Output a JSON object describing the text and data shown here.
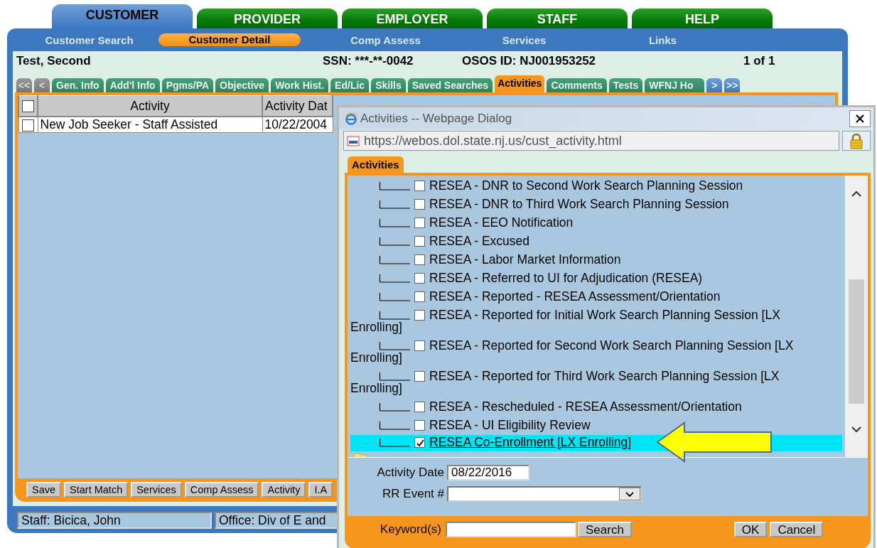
{
  "main_tabs": [
    {
      "label": "CUSTOMER",
      "selected": true
    },
    {
      "label": "PROVIDER",
      "selected": false
    },
    {
      "label": "EMPLOYER",
      "selected": false
    },
    {
      "label": "STAFF",
      "selected": false
    },
    {
      "label": "HELP",
      "selected": false
    }
  ],
  "sub_nav": [
    {
      "label": "Customer Search",
      "selected": false
    },
    {
      "label": "Customer Detail",
      "selected": true
    },
    {
      "label": "Comp Assess",
      "selected": false
    },
    {
      "label": "Services",
      "selected": false
    },
    {
      "label": "Links",
      "selected": false
    }
  ],
  "customer": {
    "name": "Test, Second",
    "ssn": "SSN: ***-**-0042",
    "osos_id": "OSOS ID: NJ001953252",
    "record_count": "1 of 1"
  },
  "detail_tabs": [
    {
      "label": "<<",
      "kind": "nav",
      "disabled": true,
      "selected": false
    },
    {
      "label": "<",
      "kind": "nav",
      "disabled": true,
      "selected": false
    },
    {
      "label": "Gen. Info",
      "kind": "tab",
      "selected": false
    },
    {
      "label": "Add'l Info",
      "kind": "tab",
      "selected": false
    },
    {
      "label": "Pgms/PA",
      "kind": "tab",
      "selected": false
    },
    {
      "label": "Objective",
      "kind": "tab",
      "selected": false
    },
    {
      "label": "Work Hist.",
      "kind": "tab",
      "selected": false
    },
    {
      "label": "Ed/Lic",
      "kind": "tab",
      "selected": false
    },
    {
      "label": "Skills",
      "kind": "tab",
      "selected": false
    },
    {
      "label": "Saved Searches",
      "kind": "tab",
      "selected": false
    },
    {
      "label": "Activities",
      "kind": "tab",
      "selected": true
    },
    {
      "label": "Comments",
      "kind": "tab",
      "selected": false
    },
    {
      "label": "Tests",
      "kind": "tab",
      "selected": false
    },
    {
      "label": "WFNJ Ho",
      "kind": "tab",
      "selected": false
    },
    {
      "label": ">",
      "kind": "nav",
      "disabled": false,
      "selected": false
    },
    {
      "label": ">>",
      "kind": "nav",
      "disabled": false,
      "selected": false
    }
  ],
  "table": {
    "select_all_checked": false,
    "columns": [
      "Activity",
      "Activity Dat"
    ],
    "rows": [
      {
        "checked": false,
        "cells": [
          "New Job Seeker - Staff Assisted",
          "10/22/2004"
        ]
      }
    ]
  },
  "buttons": [
    "Save",
    "Start Match",
    "Services",
    "Comp Assess",
    "Activity",
    "I.A"
  ],
  "status_bar": [
    "Staff: Bicica, John",
    "Office: Div of E and"
  ],
  "dialog": {
    "title": "Activities -- Webpage Dialog",
    "url": "https://webos.dol.state.nj.us/cust_activity.html",
    "tab": "Activities",
    "tree_items": [
      {
        "label": "RESEA - DNR to Second Work Search Planning Session",
        "checked": false,
        "selected": false
      },
      {
        "label": "RESEA - DNR to Third Work Search Planning Session",
        "checked": false,
        "selected": false
      },
      {
        "label": "RESEA - EEO Notification",
        "checked": false,
        "selected": false
      },
      {
        "label": "RESEA - Excused",
        "checked": false,
        "selected": false
      },
      {
        "label": "RESEA - Labor Market Information",
        "checked": false,
        "selected": false
      },
      {
        "label": "RESEA - Referred to UI for Adjudication (RESEA)",
        "checked": false,
        "selected": false
      },
      {
        "label": "RESEA - Reported - RESEA Assessment/Orientation",
        "checked": false,
        "selected": false
      },
      {
        "label": "RESEA - Reported for Initial Work Search Planning Session [LX Enrolling]",
        "checked": false,
        "selected": false
      },
      {
        "label": "RESEA - Reported for Second Work Search Planning Session [LX Enrolling]",
        "checked": false,
        "selected": false
      },
      {
        "label": "RESEA - Reported for Third Work Search Planning Session [LX Enrolling]",
        "checked": false,
        "selected": false
      },
      {
        "label": "RESEA - Rescheduled - RESEA Assessment/Orientation",
        "checked": false,
        "selected": false
      },
      {
        "label": "RESEA - UI Eligibility Review",
        "checked": false,
        "selected": false
      },
      {
        "label": "RESEA Co-Enrollment [LX Enrolling]",
        "checked": true,
        "selected": true
      }
    ],
    "activity_date": {
      "label": "Activity Date",
      "value": "08/22/2016"
    },
    "rr_event": {
      "label": "RR Event #"
    },
    "keyword": {
      "label": "Keyword(s)"
    },
    "search_button": "Search",
    "ok_button": "OK",
    "cancel_button": "Cancel"
  }
}
